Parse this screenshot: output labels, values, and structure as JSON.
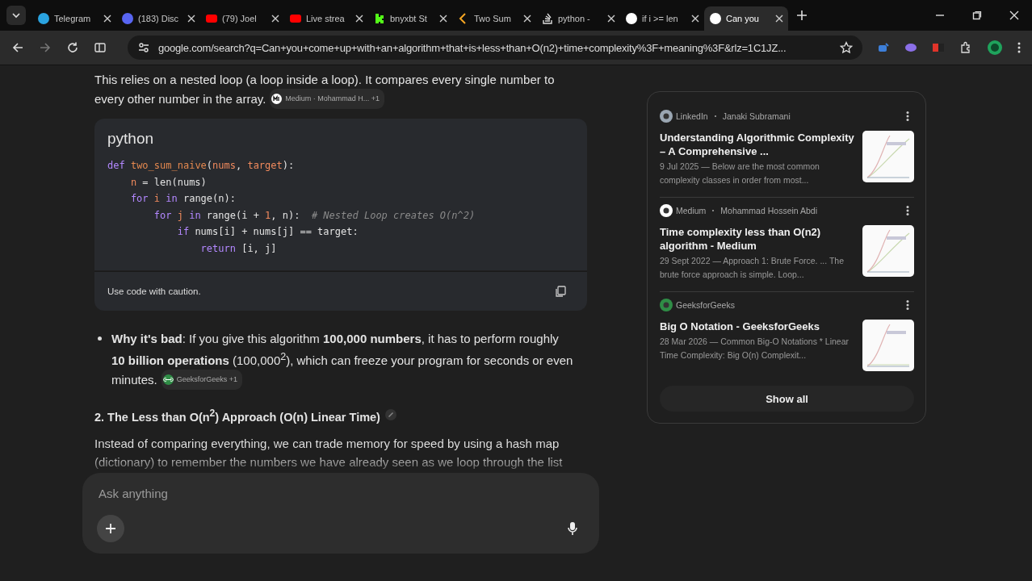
{
  "tabs": [
    {
      "label": "Telegram",
      "selected": false
    },
    {
      "label": "(183) Disc",
      "selected": false
    },
    {
      "label": "(79) Joel",
      "selected": false
    },
    {
      "label": "Live strea",
      "selected": false
    },
    {
      "label": "bnyxbt St",
      "selected": false
    },
    {
      "label": "Two Sum",
      "selected": false
    },
    {
      "label": "python -",
      "selected": false
    },
    {
      "label": "if i >= len",
      "selected": false
    },
    {
      "label": "Can you",
      "selected": true
    }
  ],
  "address": "google.com/search?q=Can+you+come+up+with+an+algorithm+that+is+less+than+O(n2)+time+complexity%3F+meaning%3F&rlz=1C1JZ...",
  "intro": {
    "text": "This relies on a nested loop (a loop inside a loop). It compares every single number to",
    "tail": "every other number in the array.",
    "chip": "Medium · Mohammad H... +1"
  },
  "code": {
    "language": "python",
    "lines": [
      [
        {
          "kind": "kw",
          "t": "def "
        },
        {
          "kind": "fn",
          "t": "two_sum_naive"
        },
        {
          "kind": "plain",
          "t": "("
        },
        {
          "kind": "var",
          "t": "nums"
        },
        {
          "kind": "plain",
          "t": ", "
        },
        {
          "kind": "var",
          "t": "target"
        },
        {
          "kind": "plain",
          "t": "):"
        }
      ],
      [
        {
          "kind": "var",
          "t": "    n"
        },
        {
          "kind": "plain",
          "t": " = len(nums)"
        }
      ],
      [
        {
          "kind": "kw",
          "t": "    for "
        },
        {
          "kind": "var",
          "t": "i"
        },
        {
          "kind": "kw",
          "t": " in "
        },
        {
          "kind": "plain",
          "t": "range(n):"
        }
      ],
      [
        {
          "kind": "kw",
          "t": "        for "
        },
        {
          "kind": "var",
          "t": "j"
        },
        {
          "kind": "kw",
          "t": " in "
        },
        {
          "kind": "plain",
          "t": "range(i + "
        },
        {
          "kind": "var",
          "t": "1"
        },
        {
          "kind": "plain",
          "t": ", n):  "
        },
        {
          "kind": "comment",
          "t": "# Nested Loop creates O(n^2)"
        }
      ],
      [
        {
          "kind": "kw",
          "t": "            if "
        },
        {
          "kind": "plain",
          "t": "nums[i] + nums[j] == target:"
        }
      ],
      [
        {
          "kind": "kw",
          "t": "                return "
        },
        {
          "kind": "plain",
          "t": "[i, j]"
        }
      ]
    ],
    "caution": "Use code with caution."
  },
  "bullet": {
    "text": "**Why it's bad**: If you give this algorithm **100,000 numbers**, it has to perform roughly **10 billion operations** (100,000$^{2}$), which can freeze your program for seconds or even",
    "tail": "minutes.",
    "chip": "GeeksforGeeks +1"
  },
  "heading": "2. The Less than O(n$^{2}$) Approach (O(n) Linear Time)",
  "paragraph": "Instead of comparing everything, we can trade memory for speed by using a hash map (dictionary) to remember the numbers we have already seen as we loop through the list",
  "ask": {
    "placeholder": "Ask anything"
  },
  "sources": [
    {
      "site": "LinkedIn",
      "author": "Janaki Subramani",
      "title": "Understanding Algorithmic Complexity – A Comprehensive ...",
      "snippet": "9 Jul 2025 — Below are the most common complexity classes in order from most..."
    },
    {
      "site": "Medium",
      "author": "Mohammad Hossein Abdi",
      "title": "Time complexity less than O(n2) algorithm - Medium",
      "snippet": "29 Sept 2022 — Approach 1: Brute Force. ... The brute force approach is simple. Loop..."
    },
    {
      "site": "GeeksforGeeks",
      "title": "Big O Notation - GeeksforGeeks",
      "snippet": "28 Mar 2026 — Common Big-O Notations * Linear Time Complexity: Big O(n) Complexit..."
    }
  ],
  "show_all": "Show all"
}
